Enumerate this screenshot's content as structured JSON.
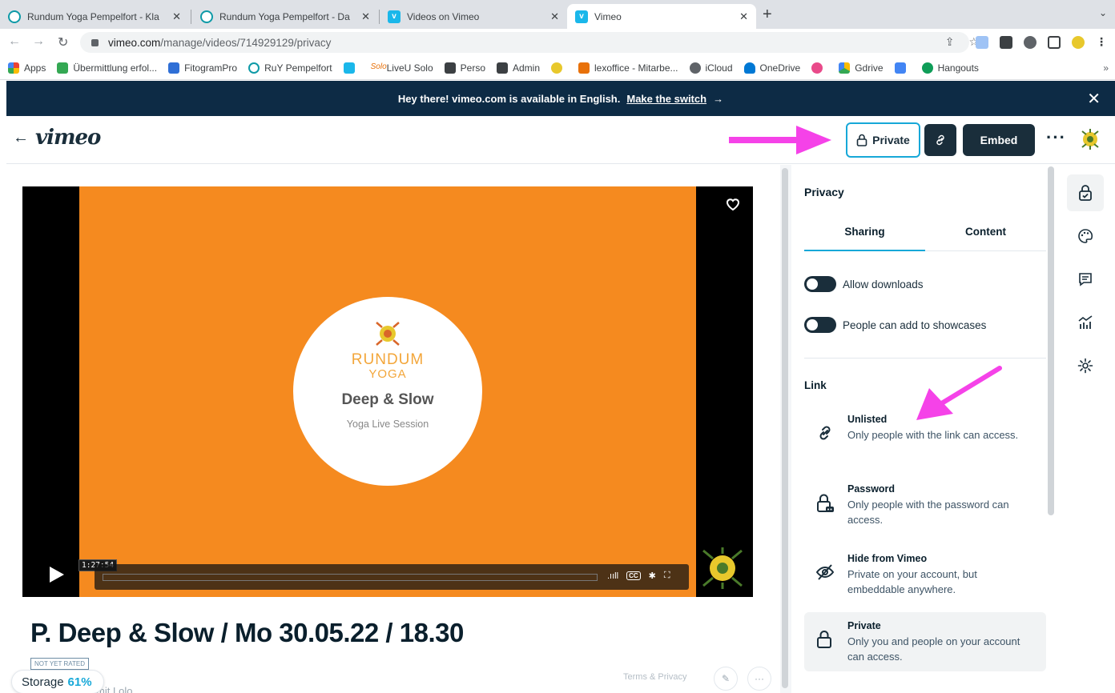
{
  "browser": {
    "tabs": [
      {
        "title": "Rundum Yoga Pempelfort - Kla"
      },
      {
        "title": "Rundum Yoga Pempelfort - Da"
      },
      {
        "title": "Videos on Vimeo"
      },
      {
        "title": "Vimeo"
      }
    ],
    "url_host": "vimeo.com",
    "url_path": "/manage/videos/714929129/privacy",
    "bookmarks": [
      "Apps",
      "Übermittlung erfol...",
      "FitogramPro",
      "RuY Pempelfort",
      "LiveU Solo",
      "Perso",
      "Admin",
      "lexoffice - Mitarbe...",
      "iCloud",
      "OneDrive",
      "Gdrive",
      "Hangouts"
    ],
    "bookmarks_more": "»"
  },
  "banner": {
    "text": "Hey there! vimeo.com is available in English.",
    "switch_label": "Make the switch",
    "arrow": "→",
    "close": "✕"
  },
  "header": {
    "back": "←",
    "logo": "vimeo",
    "private_label": "Private",
    "embed_label": "Embed",
    "more": "···"
  },
  "player": {
    "brand_line1": "RUNDUM",
    "brand_line2": "YOGA",
    "slide_title": "Deep & Slow",
    "slide_subtitle": "Yoga Live Session",
    "timecode": "1:27:54",
    "cc": "CC",
    "volume": ".ııll"
  },
  "video": {
    "title": "P. Deep & Slow / Mo 30.05.22 / 18.30",
    "rating": "NOT YET RATED",
    "uploader": "mit Lolo"
  },
  "storage": {
    "label": "Storage",
    "percent": "61%"
  },
  "footer": {
    "terms": "Terms & Privacy"
  },
  "privacy": {
    "title": "Privacy",
    "tabs": [
      "Sharing",
      "Content"
    ],
    "toggles": [
      "Allow downloads",
      "People can add to showcases"
    ],
    "link_label": "Link",
    "options": [
      {
        "name": "Unlisted",
        "desc": "Only people with the link can access."
      },
      {
        "name": "Password",
        "desc": "Only people with the password can access."
      },
      {
        "name": "Hide from Vimeo",
        "desc": "Private on your account, but embeddable anywhere."
      },
      {
        "name": "Private",
        "desc": "Only you and people on your account can access."
      }
    ],
    "selected": "Private"
  },
  "colors": {
    "accent": "#17a8d8",
    "navy": "#1a2e3b",
    "banner": "#0d2b45",
    "video_bg": "#f58a1f",
    "annotation_arrow": "#f542e8"
  }
}
